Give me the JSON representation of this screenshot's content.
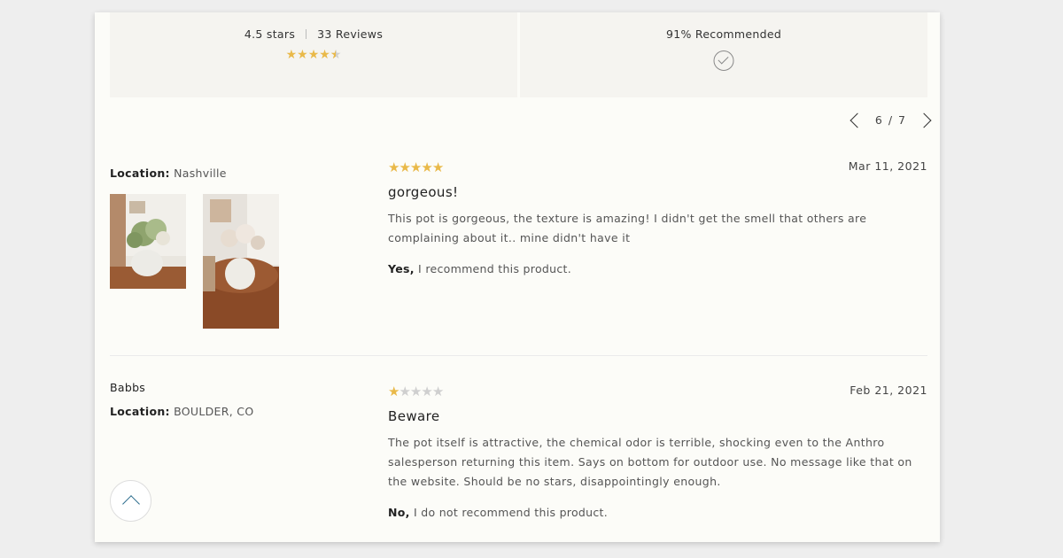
{
  "summary": {
    "rating_text": "4.5 stars",
    "rating_value": 4.5,
    "reviews_text": "33 Reviews",
    "recommended_text": "91% Recommended"
  },
  "pager": {
    "current": "6",
    "separator": "/",
    "total": "7"
  },
  "reviews": [
    {
      "author": "",
      "location_label": "Location:",
      "location": "Nashville",
      "rating": 5,
      "date": "Mar 11, 2021",
      "title": "gorgeous!",
      "text": "This pot is gorgeous, the texture is amazing! I didn't get the smell that others are complaining about it.. mine didn't have it",
      "rec_bold": "Yes,",
      "rec_text": " I recommend this product."
    },
    {
      "author": "Babbs",
      "location_label": "Location:",
      "location": "BOULDER, CO",
      "rating": 1,
      "date": "Feb 21, 2021",
      "title": "Beware",
      "text": "The pot itself is attractive, the chemical odor is terrible, shocking even to the Anthro salesperson returning this item. Says on bottom for outdoor use. No message like that on the website. Should be no stars, disappointingly enough.",
      "rec_bold": "No,",
      "rec_text": " I do not recommend this product."
    }
  ],
  "colors": {
    "star": "#e9b949",
    "star_empty": "#cfcfcf",
    "accent": "#2a6b8c"
  },
  "icons": {
    "prev": "chevron-left-icon",
    "next": "chevron-right-icon",
    "check": "check-circle-icon",
    "top": "chevron-up-icon"
  }
}
